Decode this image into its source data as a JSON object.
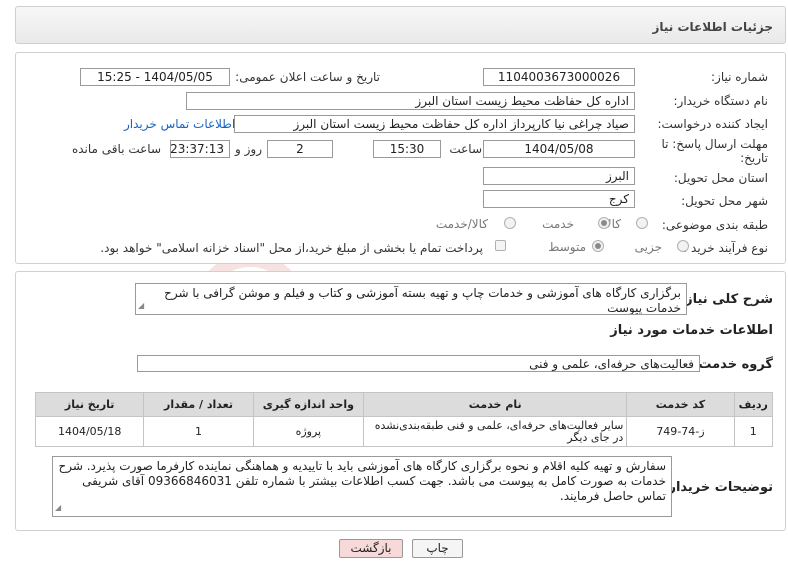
{
  "header": {
    "title": "جزئیات اطلاعات نیاز"
  },
  "fields": {
    "need_number_label": "شماره نیاز:",
    "need_number": "1104003673000026",
    "announce_label": "تاریخ و ساعت اعلان عمومی:",
    "announce_value": "1404/05/05 - 15:25",
    "buyer_org_label": "نام دستگاه خریدار:",
    "buyer_org": "اداره کل حفاظت محیط زیست استان البرز",
    "creator_label": "ایجاد کننده درخواست:",
    "creator": "صیاد چراغی نیا کارپرداز اداره کل حفاظت محیط زیست استان البرز",
    "contact_link": "اطلاعات تماس خریدار",
    "deadline_label_1": "مهلت ارسال پاسخ: تا",
    "deadline_label_2": "تاریخ:",
    "deadline_date": "1404/05/08",
    "time_label": "ساعت",
    "deadline_time": "15:30",
    "days": "2",
    "days_label": "روز و",
    "remaining_time": "23:37:13",
    "remaining_label": "ساعت باقی مانده",
    "province_label": "استان محل تحویل:",
    "province": "البرز",
    "city_label": "شهر محل تحویل:",
    "city": "کرج",
    "category_label": "طبقه بندی موضوعی:",
    "category_options": [
      "کالا",
      "خدمت",
      "کالا/خدمت"
    ],
    "category_selected": "خدمت",
    "process_label": "نوع فرآیند خرید :",
    "process_options": [
      "جزیی",
      "متوسط"
    ],
    "process_selected": "متوسط",
    "payment_note": "پرداخت تمام یا بخشی از مبلغ خرید،از محل \"اسناد خزانه اسلامی\" خواهد بود."
  },
  "summary": {
    "label": "شرح کلی نیاز:",
    "text": "برگزاری کارگاه های آموزشی و خدمات چاپ و تهیه بسته آموزشی و کتاب و فیلم و موشن گرافی با شرح خدمات پیوست"
  },
  "services": {
    "section_title": "اطلاعات خدمات مورد نیاز",
    "group_label": "گروه خدمت:",
    "group_value": "فعالیت‌های حرفه‌ای، علمی و فنی",
    "columns": [
      "ردیف",
      "کد خدمت",
      "نام خدمت",
      "واحد اندازه گیری",
      "تعداد / مقدار",
      "تاریخ نیاز"
    ],
    "rows": [
      [
        "1",
        "ز-74-749",
        "سایر فعالیت‌های حرفه‌ای، علمی و فنی طبقه‌بندی‌نشده در جای دیگر",
        "پروژه",
        "1",
        "1404/05/18"
      ]
    ]
  },
  "buyer_notes": {
    "label": "توضیحات خریدار:",
    "text": "سفارش و تهیه کلیه اقلام و نحوه برگزاری کارگاه های آموزشی باید با تاییدیه و هماهنگی نماینده کارفرما صورت پذیرد. شرح خدمات به صورت کامل به پیوست می باشد. جهت کسب اطلاعات بیشتر با شماره تلفن 09366846031 آقای شریفی تماس حاصل فرمایند."
  },
  "buttons": {
    "print": "چاپ",
    "back": "بازگشت"
  },
  "colors": {
    "back_button_bg": "#f7d9d9",
    "link": "#1565c0",
    "table_header_bg": "#dcdcdc"
  }
}
